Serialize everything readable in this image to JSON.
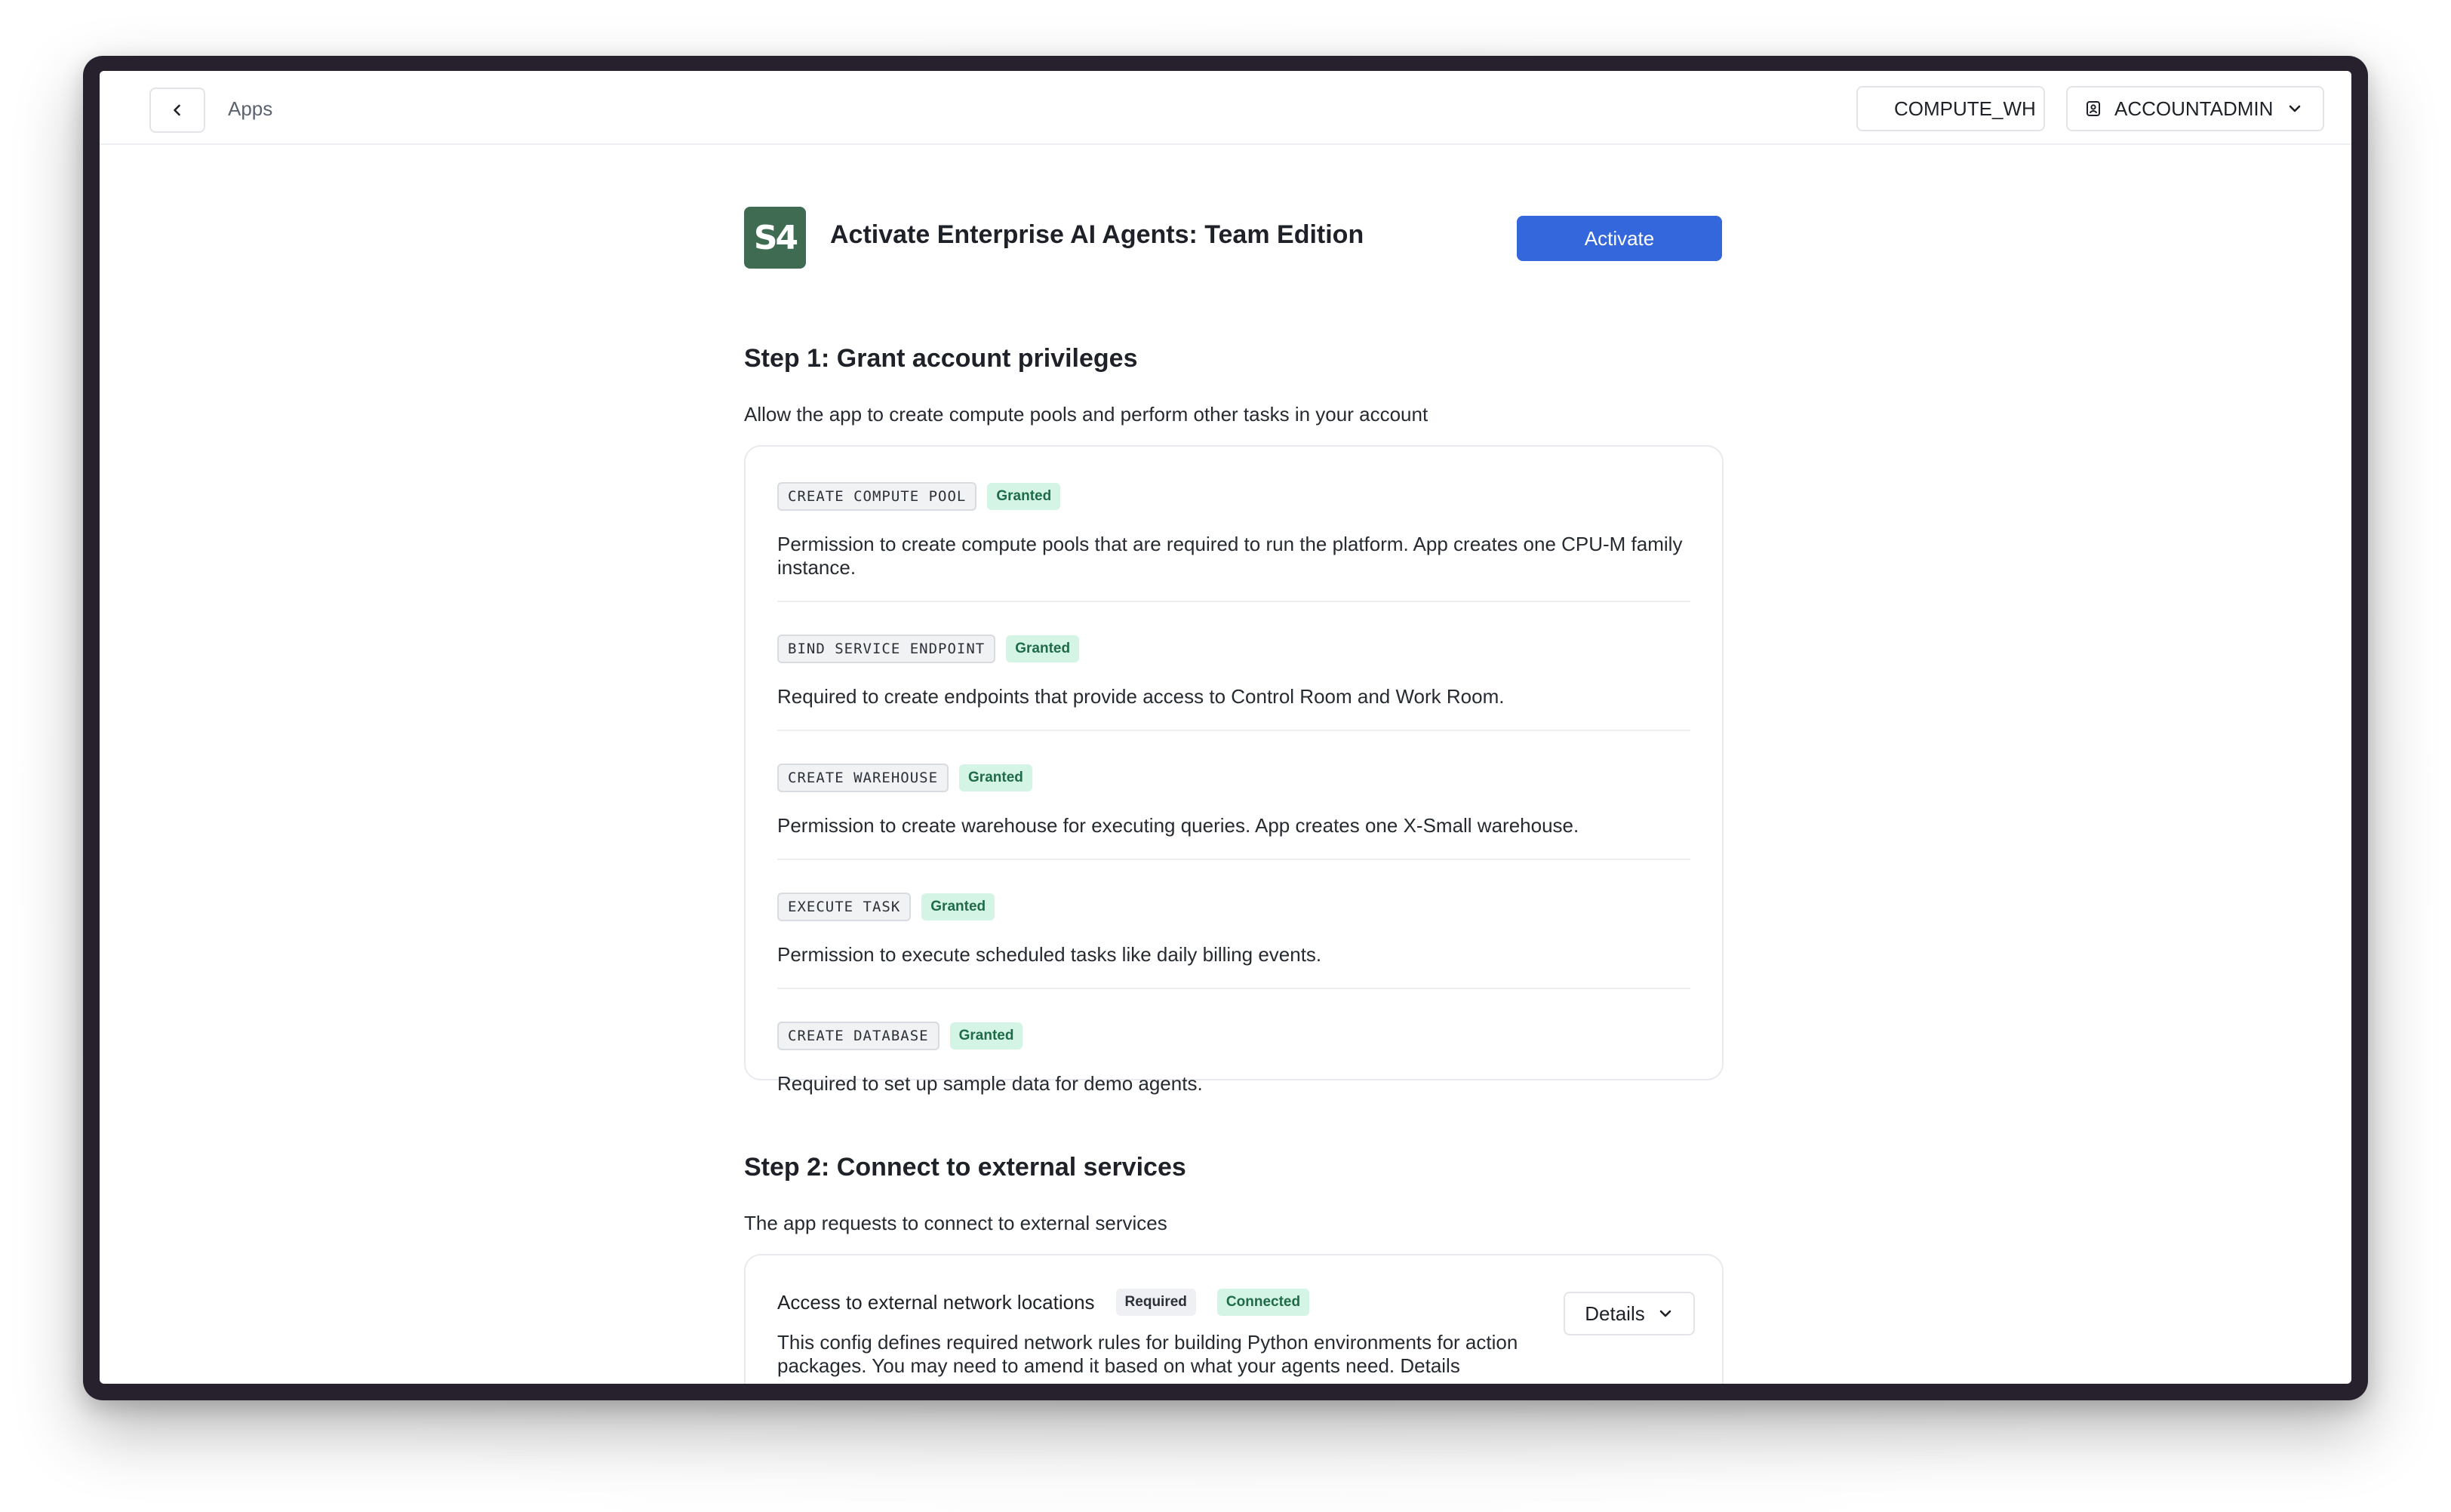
{
  "topbar": {
    "breadcrumb": "Apps",
    "warehouse": "COMPUTE_WH",
    "role": "ACCOUNTADMIN"
  },
  "app": {
    "logo_text": "S4",
    "title": "Activate Enterprise AI Agents: Team Edition",
    "activate_label": "Activate"
  },
  "step1": {
    "title": "Step 1: Grant account privileges",
    "description": "Allow the app to create compute pools and perform other tasks in your account",
    "privileges": [
      {
        "name": "CREATE COMPUTE POOL",
        "status": "Granted",
        "description": "Permission to create compute pools that are required to run the platform. App creates one CPU-M family instance."
      },
      {
        "name": "BIND SERVICE ENDPOINT",
        "status": "Granted",
        "description": "Required to create endpoints that provide access to Control Room and Work Room."
      },
      {
        "name": "CREATE WAREHOUSE",
        "status": "Granted",
        "description": "Permission to create warehouse for executing queries. App creates one X-Small warehouse."
      },
      {
        "name": "EXECUTE TASK",
        "status": "Granted",
        "description": "Permission to execute scheduled tasks like daily billing events."
      },
      {
        "name": "CREATE DATABASE",
        "status": "Granted",
        "description": "Required to set up sample data for demo agents."
      }
    ]
  },
  "step2": {
    "title": "Step 2: Connect to external services",
    "description": "The app requests to connect to external services",
    "connection": {
      "title": "Access to external network locations",
      "required_badge": "Required",
      "status_badge": "Connected",
      "description": "This config defines required network rules for building Python environments for action packages. You may need to amend it based on what your agents need. Details",
      "details_label": "Details"
    }
  },
  "colors": {
    "accent": "#3367db",
    "granted_bg": "#d4f4e6",
    "granted_text": "#1f6b48",
    "logo_bg": "#3e6b51"
  }
}
